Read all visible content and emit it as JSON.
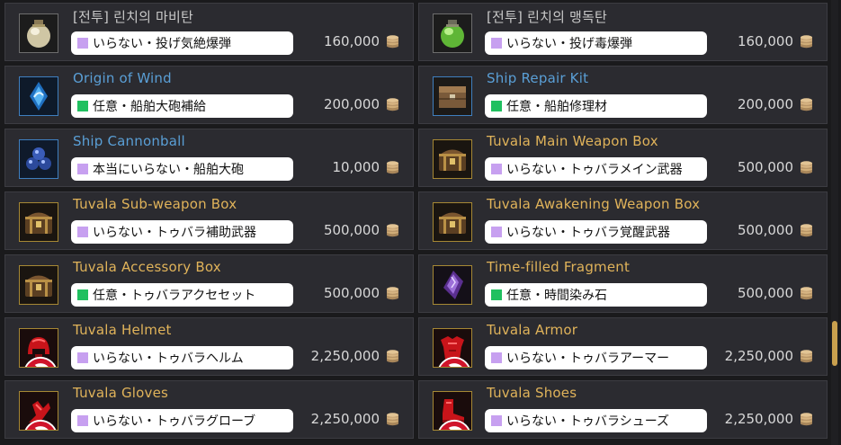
{
  "colors": {
    "unneeded_tag": "#c7a0f0",
    "optional_tag": "#20c060",
    "name_gold": "#e0b35a",
    "name_blue": "#5a9fd6",
    "name_gray": "#c8c8c8",
    "scroll_thumb": "#c9a04e"
  },
  "items": [
    {
      "name": "[전투] 린치의 마비탄",
      "name_color": "gray",
      "icon": "lynch-paralysis-bomb-icon",
      "frame": "gray",
      "tag": "いらない・投げ気絶爆弾",
      "tag_type": "unneeded",
      "price": "160,000"
    },
    {
      "name": "[전투] 린치의 맹독탄",
      "name_color": "gray",
      "icon": "lynch-poison-bomb-icon",
      "frame": "gray",
      "tag": "いらない・投げ毒爆弾",
      "tag_type": "unneeded",
      "price": "160,000"
    },
    {
      "name": "Origin of Wind",
      "name_color": "blue",
      "icon": "wind-crystal-icon",
      "frame": "blue",
      "tag": "任意・船舶大砲補給",
      "tag_type": "optional",
      "price": "200,000"
    },
    {
      "name": "Ship Repair Kit",
      "name_color": "blue",
      "icon": "repair-kit-icon",
      "frame": "blue",
      "tag": "任意・船舶修理材",
      "tag_type": "optional",
      "price": "200,000"
    },
    {
      "name": "Ship Cannonball",
      "name_color": "blue",
      "icon": "cannonball-icon",
      "frame": "blue",
      "tag": "本当にいらない・船舶大砲",
      "tag_type": "unneeded",
      "price": "10,000"
    },
    {
      "name": "Tuvala Main Weapon Box",
      "name_color": "gold",
      "icon": "treasure-box-icon",
      "frame": "gold",
      "tag": "いらない・トゥバラメイン武器",
      "tag_type": "unneeded",
      "price": "500,000"
    },
    {
      "name": "Tuvala Sub-weapon Box",
      "name_color": "gold",
      "icon": "treasure-box-icon",
      "frame": "gold",
      "tag": "いらない・トゥバラ補助武器",
      "tag_type": "unneeded",
      "price": "500,000"
    },
    {
      "name": "Tuvala Awakening Weapon Box",
      "name_color": "gold",
      "icon": "treasure-box-icon",
      "frame": "gold",
      "tag": "いらない・トゥバラ覚醒武器",
      "tag_type": "unneeded",
      "price": "500,000"
    },
    {
      "name": "Tuvala Accessory Box",
      "name_color": "gold",
      "icon": "treasure-box-icon",
      "frame": "gold",
      "tag": "任意・トゥバラアクセセット",
      "tag_type": "optional",
      "price": "500,000"
    },
    {
      "name": "Time-filled Fragment",
      "name_color": "gold",
      "icon": "time-fragment-icon",
      "frame": "gold",
      "tag": "任意・時間染み石",
      "tag_type": "optional",
      "price": "500,000"
    },
    {
      "name": "Tuvala Helmet",
      "name_color": "gold",
      "icon": "helmet-icon",
      "frame": "gold",
      "tag": "いらない・トゥバラヘルム",
      "tag_type": "unneeded",
      "price": "2,250,000",
      "restricted": true
    },
    {
      "name": "Tuvala Armor",
      "name_color": "gold",
      "icon": "armor-icon",
      "frame": "gold",
      "tag": "いらない・トゥバラアーマー",
      "tag_type": "unneeded",
      "price": "2,250,000",
      "restricted": true
    },
    {
      "name": "Tuvala Gloves",
      "name_color": "gold",
      "icon": "gloves-icon",
      "frame": "gold",
      "tag": "いらない・トゥバラグローブ",
      "tag_type": "unneeded",
      "price": "2,250,000",
      "restricted": true
    },
    {
      "name": "Tuvala Shoes",
      "name_color": "gold",
      "icon": "shoes-icon",
      "frame": "gold",
      "tag": "いらない・トゥバラシューズ",
      "tag_type": "unneeded",
      "price": "2,250,000",
      "restricted": true
    }
  ]
}
